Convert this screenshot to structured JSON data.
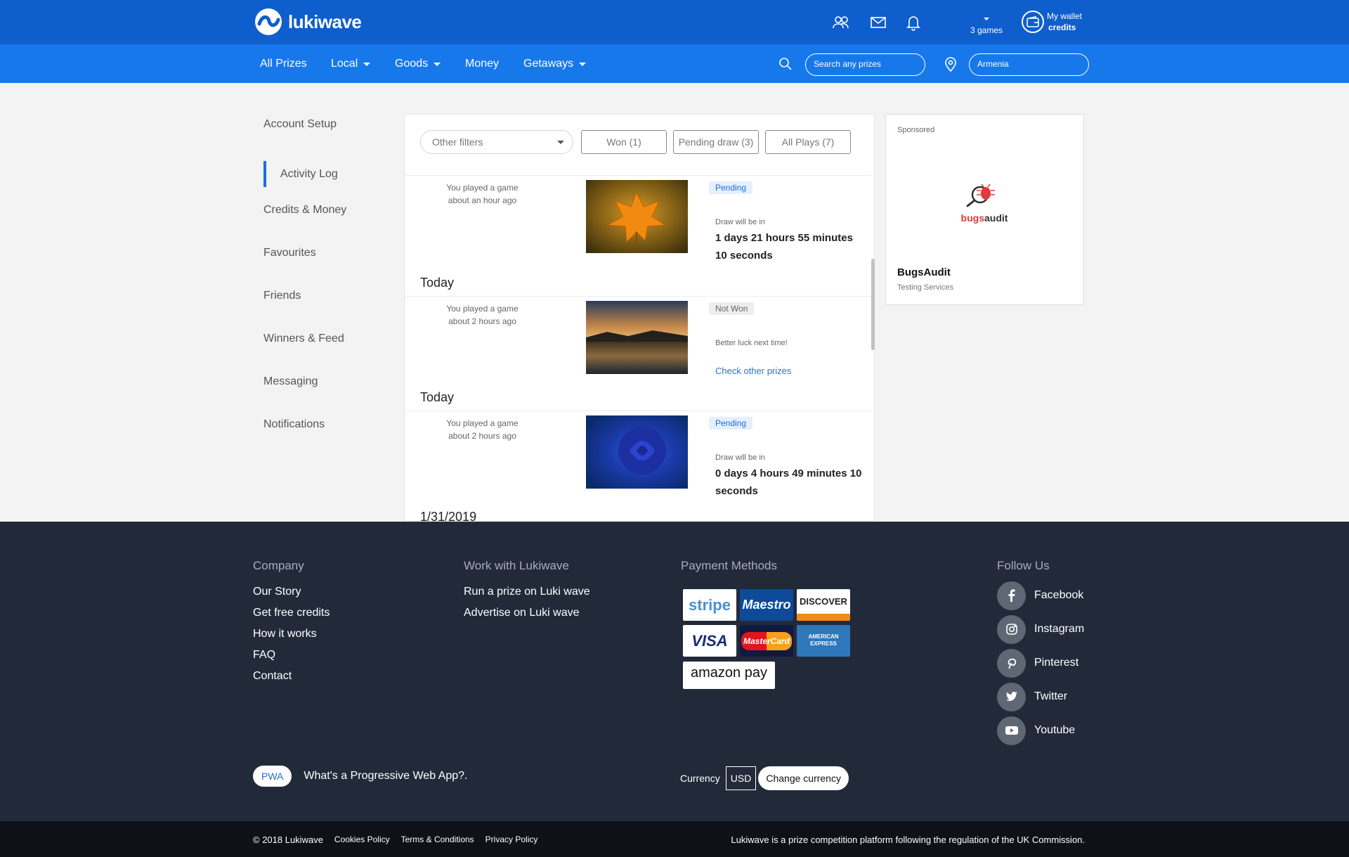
{
  "brand": {
    "name": "lukiwave"
  },
  "header": {
    "games_count": "3 games",
    "wallet_line1": "My wallet",
    "wallet_line2": "credits"
  },
  "nav": {
    "items": [
      {
        "label": "All Prizes"
      },
      {
        "label": "Local"
      },
      {
        "label": "Goods"
      },
      {
        "label": "Money"
      },
      {
        "label": "Getaways"
      }
    ],
    "search_placeholder": "Search any prizes",
    "location_value": "Armenia"
  },
  "sidebar": {
    "items": [
      {
        "label": "Account Setup"
      },
      {
        "label": "Activity Log"
      },
      {
        "label": "Credits & Money"
      },
      {
        "label": "Favourites"
      },
      {
        "label": "Friends"
      },
      {
        "label": "Winners & Feed"
      },
      {
        "label": "Messaging"
      },
      {
        "label": "Notifications"
      }
    ]
  },
  "filters": {
    "dropdown_label": "Other filters",
    "won": "Won (1)",
    "pending": "Pending draw (3)",
    "all": "All Plays (7)"
  },
  "entries": [
    {
      "line1": "You played a game",
      "line2": "about an hour ago",
      "status": "Pending",
      "sub": "Draw will be in",
      "big": "1 days 21 hours 55 minutes 10 seconds"
    },
    {
      "line1": "You played a game",
      "line2": "about 2 hours ago",
      "status": "Not Won",
      "sub": "Better luck next time!",
      "link": "Check other prizes"
    },
    {
      "line1": "You played a game",
      "line2": "about 2 hours ago",
      "status": "Pending",
      "sub": "Draw will be in",
      "big": "0 days 4 hours 49 minutes 10 seconds"
    }
  ],
  "day_headers": [
    "Today",
    "Today",
    "1/31/2019"
  ],
  "sponsored": {
    "label": "Sponsored",
    "logo_text_red": "bugs",
    "logo_text_dark": "audit",
    "name": "BugsAudit",
    "desc": "Testing Services"
  },
  "footer": {
    "company": {
      "title": "Company",
      "links": [
        "Our Story",
        "Get free credits",
        "How it works",
        "FAQ",
        "Contact"
      ]
    },
    "work": {
      "title": "Work with Lukiwave",
      "links": [
        "Run a prize on Luki wave",
        "Advertise on Luki wave"
      ]
    },
    "payment": {
      "title": "Payment Methods",
      "methods": [
        "stripe",
        "Maestro",
        "DISCOVER",
        "VISA",
        "MasterCard",
        "AMERICAN EXPRESS",
        "amazon pay"
      ]
    },
    "follow": {
      "title": "Follow Us",
      "links": [
        "Facebook",
        "Instagram",
        "Pinterest",
        "Twitter",
        "Youtube"
      ]
    },
    "pwa_badge": "PWA",
    "pwa_question": "What's a Progressive Web App?.",
    "currency_label": "Currency",
    "currency_value": "USD",
    "change_currency": "Change currency"
  },
  "bottom": {
    "copyright": "© 2018 Lukiwave",
    "cookies": "Cookies Policy",
    "terms": "Terms & Conditions",
    "privacy": "Privacy Policy",
    "regulation": "Lukiwave is a prize competition platform following the regulation of the UK Commission."
  },
  "colors": {
    "header": "#0f5ecd",
    "nav": "#1778ec",
    "accent": "#1a6fe0",
    "footer": "#222a3a",
    "bottom": "#0e1117"
  }
}
